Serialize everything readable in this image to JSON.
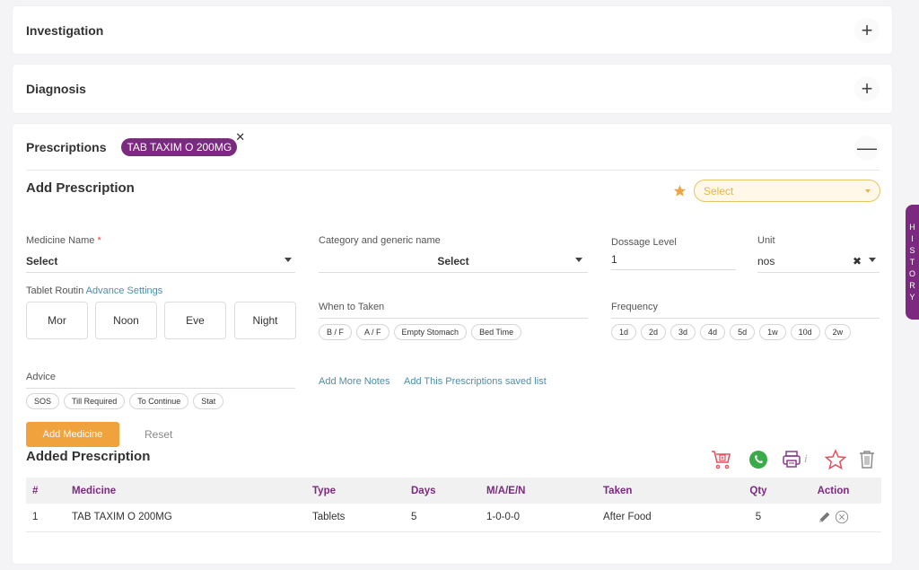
{
  "sections": {
    "investigation": {
      "title": "Investigation",
      "toggle": "+"
    },
    "diagnosis": {
      "title": "Diagnosis",
      "toggle": "+"
    },
    "prescriptions": {
      "title": "Prescriptions",
      "toggle": "—",
      "selected_chip": "TAB TAXIM O 200MG",
      "chip_remove": "✕"
    }
  },
  "add_prescription": {
    "title": "Add Prescription",
    "favorite_select": {
      "placeholder": "Select"
    },
    "medicine_name": {
      "label": "Medicine Name",
      "required_mark": "*",
      "value": "Select"
    },
    "category": {
      "label": "Category and generic name",
      "value": "Select"
    },
    "dosage": {
      "label": "Dossage Level",
      "value": "1"
    },
    "unit": {
      "label": "Unit",
      "value": "nos",
      "clear": "✖"
    },
    "tablet_routine": {
      "label": "Tablet Routin",
      "link": "Advance Settings",
      "slots": [
        "Mor",
        "Noon",
        "Eve",
        "Night"
      ]
    },
    "when_to_taken": {
      "label": "When to Taken",
      "options": [
        "B / F",
        "A / F",
        "Empty Stomach",
        "Bed Time"
      ]
    },
    "frequency": {
      "label": "Frequency",
      "options": [
        "1d",
        "2d",
        "3d",
        "4d",
        "5d",
        "1w",
        "10d",
        "2w"
      ]
    },
    "advice": {
      "label": "Advice",
      "options": [
        "SOS",
        "Till Required",
        "To Continue",
        "Stat"
      ]
    },
    "links": {
      "add_notes": "Add More Notes",
      "save_list": "Add This Prescriptions saved list"
    },
    "buttons": {
      "add_medicine": "Add Medicine",
      "reset": "Reset"
    }
  },
  "added_prescription": {
    "title": "Added Prescription",
    "toolbar_icons": [
      "cart-icon",
      "whatsapp-icon",
      "printer-icon",
      "info-icon",
      "star-icon",
      "trash-icon"
    ],
    "columns": [
      "#",
      "Medicine",
      "Type",
      "Days",
      "M/A/E/N",
      "Taken",
      "Qty",
      "Action"
    ],
    "rows": [
      {
        "num": "1",
        "medicine": "TAB TAXIM O 200MG",
        "type": "Tablets",
        "days": "5",
        "maen": "1-0-0-0",
        "taken": "After Food",
        "qty": "5"
      }
    ]
  },
  "history_tab": {
    "letters": [
      "H",
      "I",
      "S",
      "T",
      "O",
      "R",
      "Y"
    ]
  },
  "colors": {
    "brand_purple": "#7b2a7f",
    "accent_orange": "#f0a23d",
    "link_blue": "#4e8ea8",
    "star_gold": "#e8a93a"
  }
}
